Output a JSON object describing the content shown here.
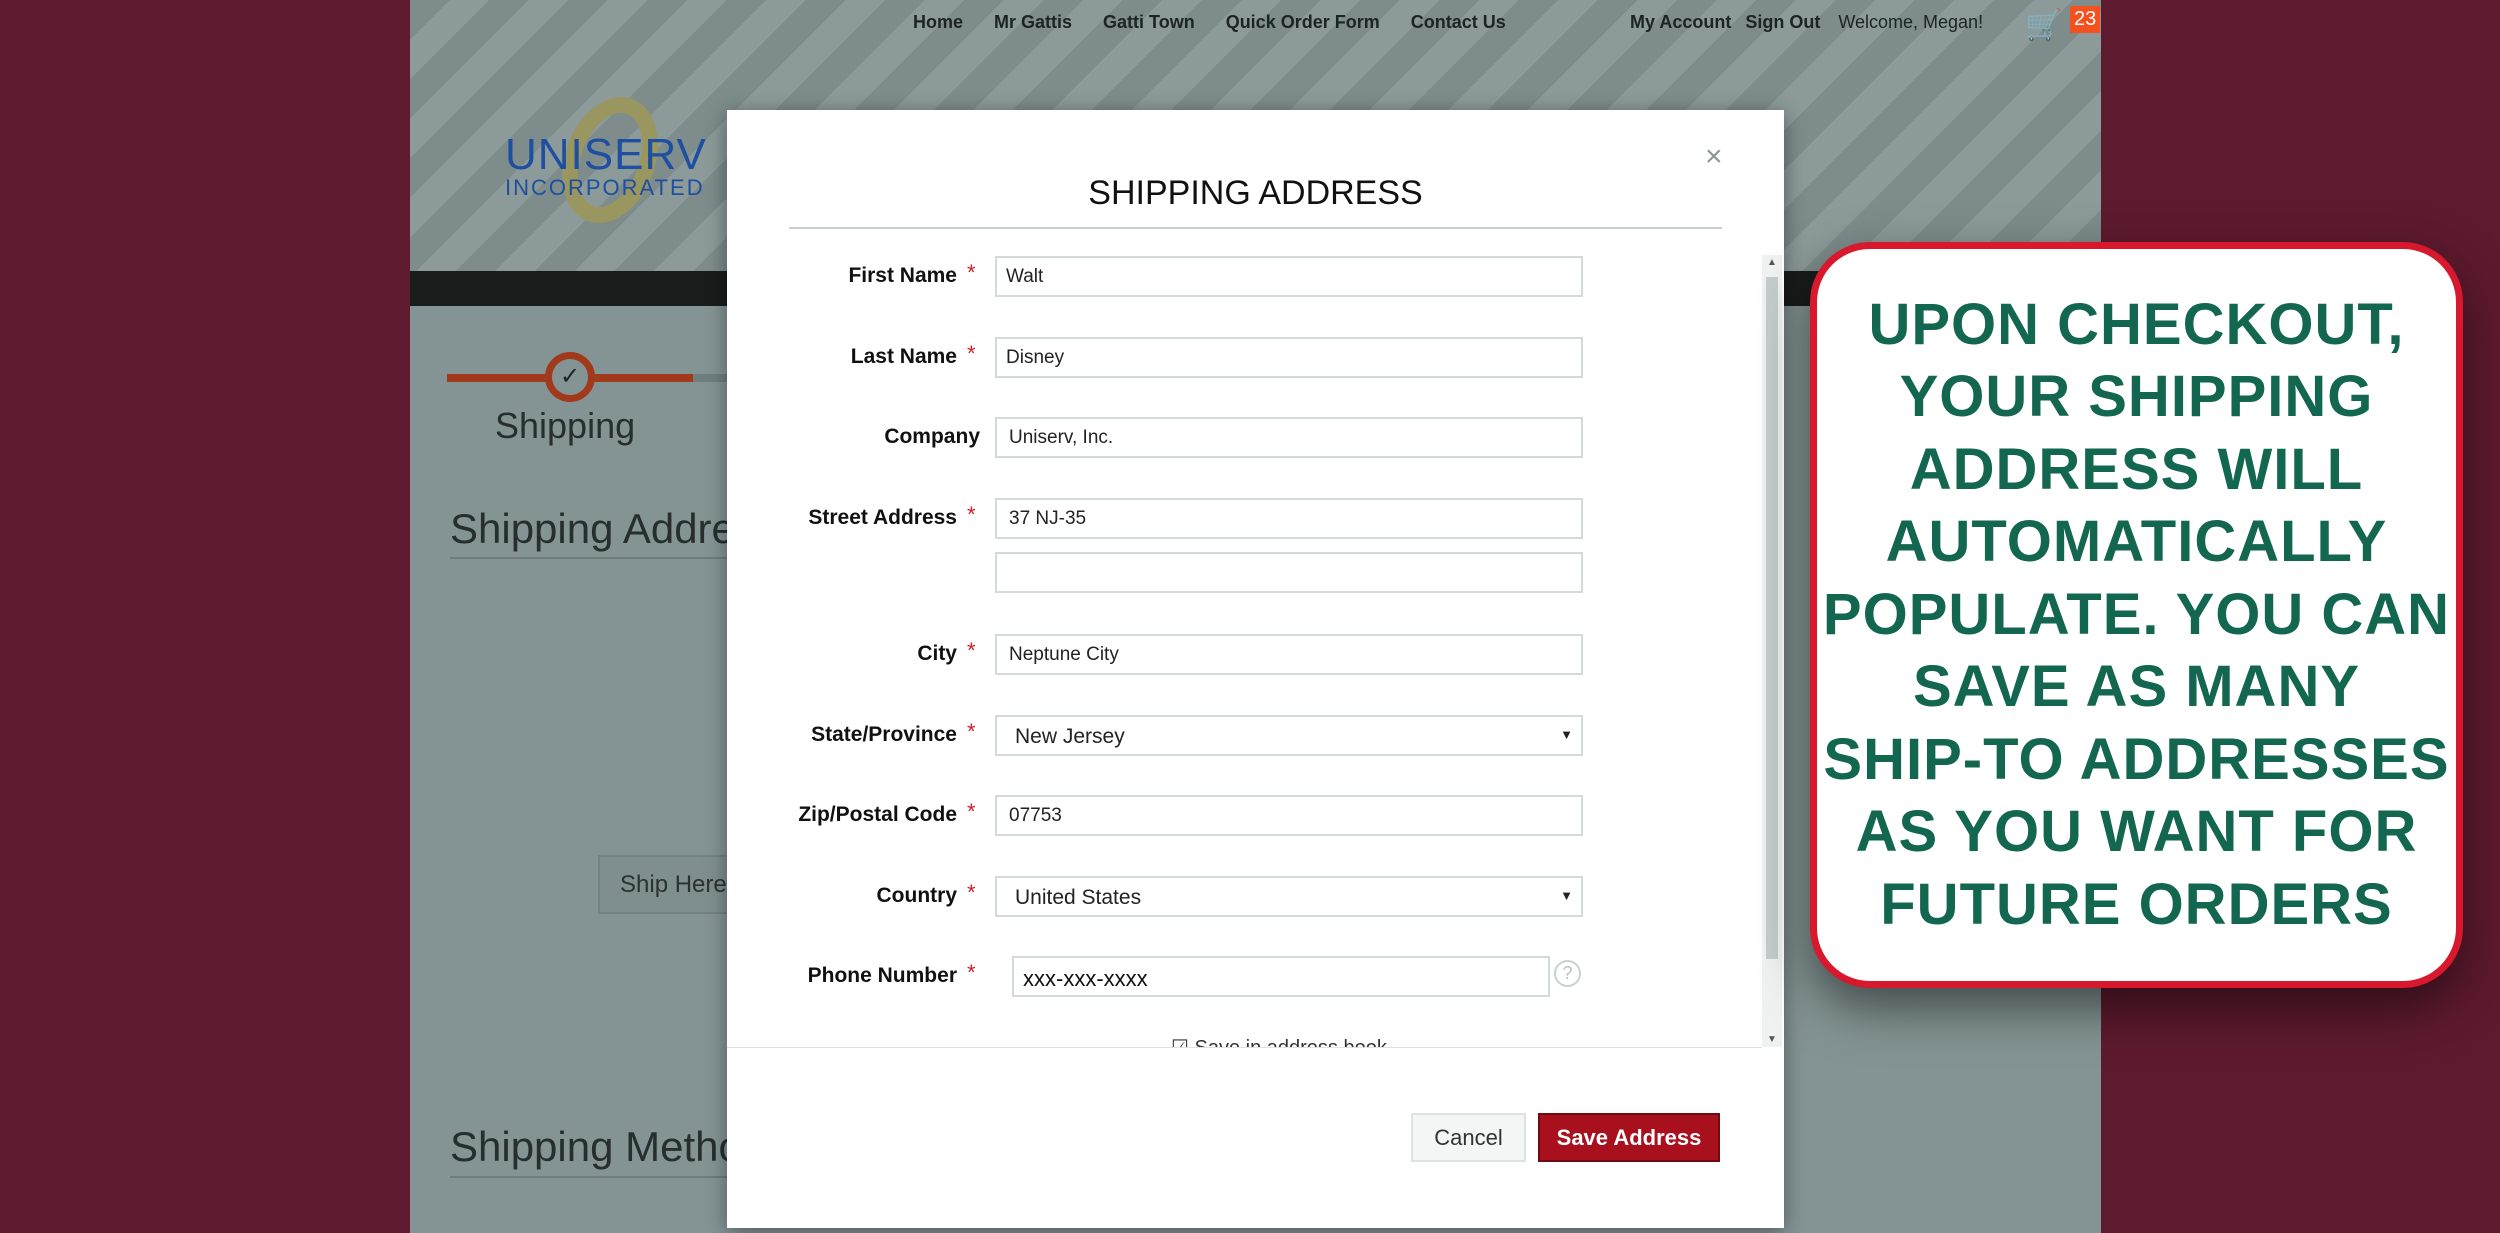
{
  "nav": {
    "links": [
      "Home",
      "Mr Gattis",
      "Gatti Town",
      "Quick Order Form",
      "Contact Us"
    ],
    "account": "My Account",
    "sign_out": "Sign Out",
    "welcome": "Welcome, Megan!",
    "cart_count": "23"
  },
  "logo": {
    "line1": "UNISERV",
    "line2": "INCORPORATED"
  },
  "background": {
    "step_label": "Shipping",
    "section1": "Shipping Addre",
    "ship_here": "Ship Here",
    "section2": "Shipping Metho"
  },
  "modal": {
    "title": "SHIPPING ADDRESS",
    "close": "×",
    "fields": {
      "first_name": {
        "label": "First Name",
        "value": "Walt"
      },
      "last_name": {
        "label": "Last Name",
        "value": "Disney"
      },
      "company": {
        "label": "Company",
        "value": "Uniserv, Inc."
      },
      "street": {
        "label": "Street Address",
        "value": "37 NJ-35",
        "value2": ""
      },
      "city": {
        "label": "City",
        "value": "Neptune City"
      },
      "state": {
        "label": "State/Province",
        "value": "New Jersey"
      },
      "zip": {
        "label": "Zip/Postal Code",
        "value": "07753"
      },
      "country": {
        "label": "Country",
        "value": "United States"
      },
      "phone": {
        "label": "Phone Number",
        "placeholder": "xxx-xxx-xxxx"
      }
    },
    "required_mark": "*",
    "save_book": "Save in address book",
    "cancel": "Cancel",
    "save": "Save Address"
  },
  "callout": {
    "lines": [
      "UPON CHECKOUT,",
      "YOUR SHIPPING",
      "ADDRESS WILL",
      "AUTOMATICALLY",
      "POPULATE. YOU CAN",
      "SAVE AS MANY",
      "SHIP-TO ADDRESSES",
      "AS YOU WANT FOR",
      "FUTURE ORDERS"
    ]
  },
  "colors": {
    "accent": "#a8101e",
    "callout_text": "#13664f",
    "callout_border": "#d8182c",
    "frame": "#5e1a2e"
  }
}
